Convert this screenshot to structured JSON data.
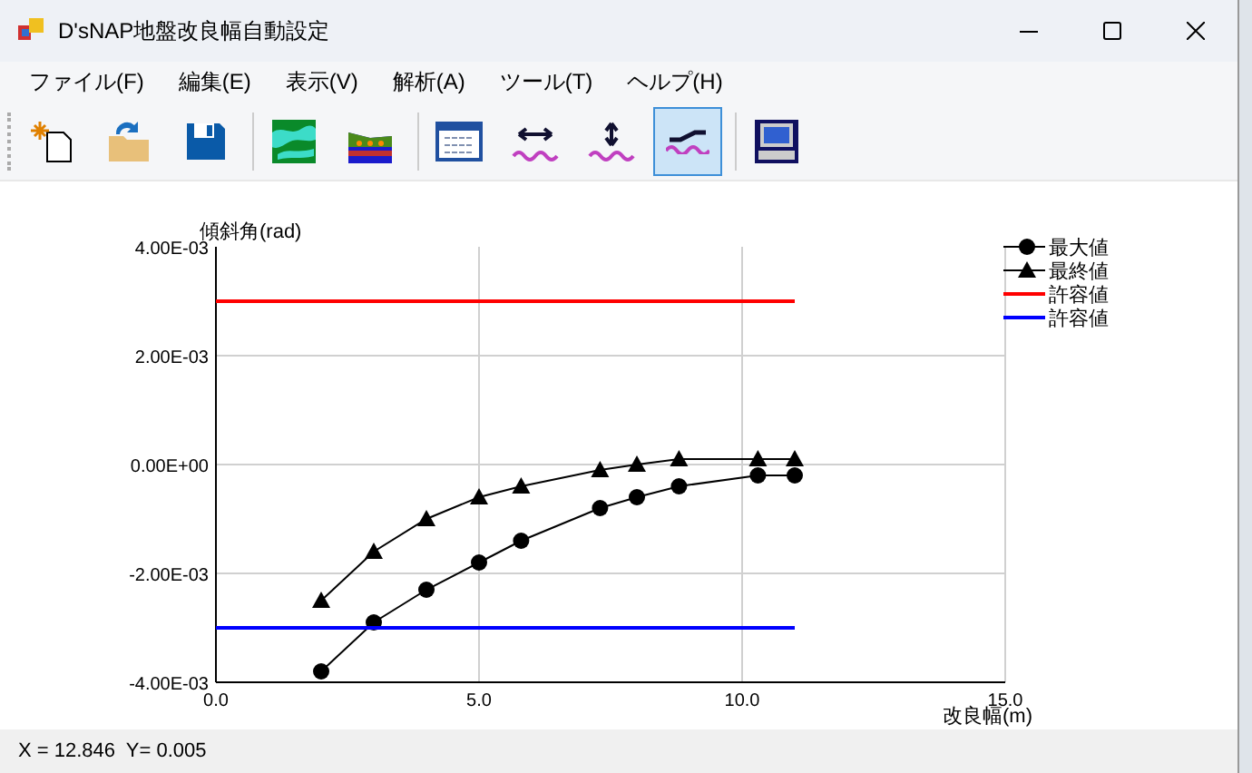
{
  "window": {
    "title": "D'sNAP地盤改良幅自動設定"
  },
  "menu": [
    "ファイル(F)",
    "編集(E)",
    "表示(V)",
    "解析(A)",
    "ツール(T)",
    "ヘルプ(H)"
  ],
  "toolbar": [
    {
      "selected": false
    },
    {
      "selected": false
    },
    {
      "selected": false
    },
    {
      "selected": false
    },
    {
      "selected": false
    },
    {
      "selected": false
    },
    {
      "selected": false
    },
    {
      "selected": false
    },
    {
      "selected": true
    },
    {
      "selected": false
    }
  ],
  "chart": {
    "chart_data": {
      "type": "line",
      "xlabel": "改良幅(m)",
      "ylabel": "傾斜角(rad)",
      "xlim": [
        0,
        15
      ],
      "ylim": [
        -0.004,
        0.004
      ],
      "xticks": [
        {
          "value": 0,
          "label": "0.0"
        },
        {
          "value": 5,
          "label": "5.0"
        },
        {
          "value": 10,
          "label": "10.0"
        },
        {
          "value": 15,
          "label": "15.0"
        }
      ],
      "yticks": [
        {
          "value": 0.004,
          "label": "4.00E-03"
        },
        {
          "value": 0.002,
          "label": "2.00E-03"
        },
        {
          "value": 0,
          "label": "0.00E+00"
        },
        {
          "value": -0.002,
          "label": "-2.00E-03"
        },
        {
          "value": -0.004,
          "label": "-4.00E-03"
        }
      ],
      "grid": true,
      "legend": "top right",
      "series": [
        {
          "name": "最大値",
          "color": "#000000",
          "marker": "circle",
          "x": [
            2,
            3,
            4,
            5,
            5.8,
            7.3,
            8,
            8.8,
            10.3,
            11
          ],
          "values": [
            -0.0038,
            -0.0029,
            -0.0023,
            -0.0018,
            -0.0014,
            -0.0008,
            -0.0006,
            -0.0004,
            -0.0002,
            -0.0002
          ]
        },
        {
          "name": "最終値",
          "color": "#000000",
          "marker": "triangle",
          "x": [
            2,
            3,
            4,
            5,
            5.8,
            7.3,
            8,
            8.8,
            10.3,
            11
          ],
          "values": [
            -0.0025,
            -0.0016,
            -0.001,
            -0.0006,
            -0.0004,
            -0.0001,
            0,
            0.0001,
            0.0001,
            0.0001
          ]
        },
        {
          "name": "許容値",
          "color": "#ff0000",
          "marker": "none",
          "x": [
            0,
            11
          ],
          "values": [
            0.003,
            0.003
          ]
        },
        {
          "name": "許容値",
          "color": "#0000ff",
          "marker": "none",
          "x": [
            0,
            11
          ],
          "values": [
            -0.003,
            -0.003
          ]
        }
      ]
    }
  },
  "status_bar": "X = 12.846  Y= 0.005"
}
